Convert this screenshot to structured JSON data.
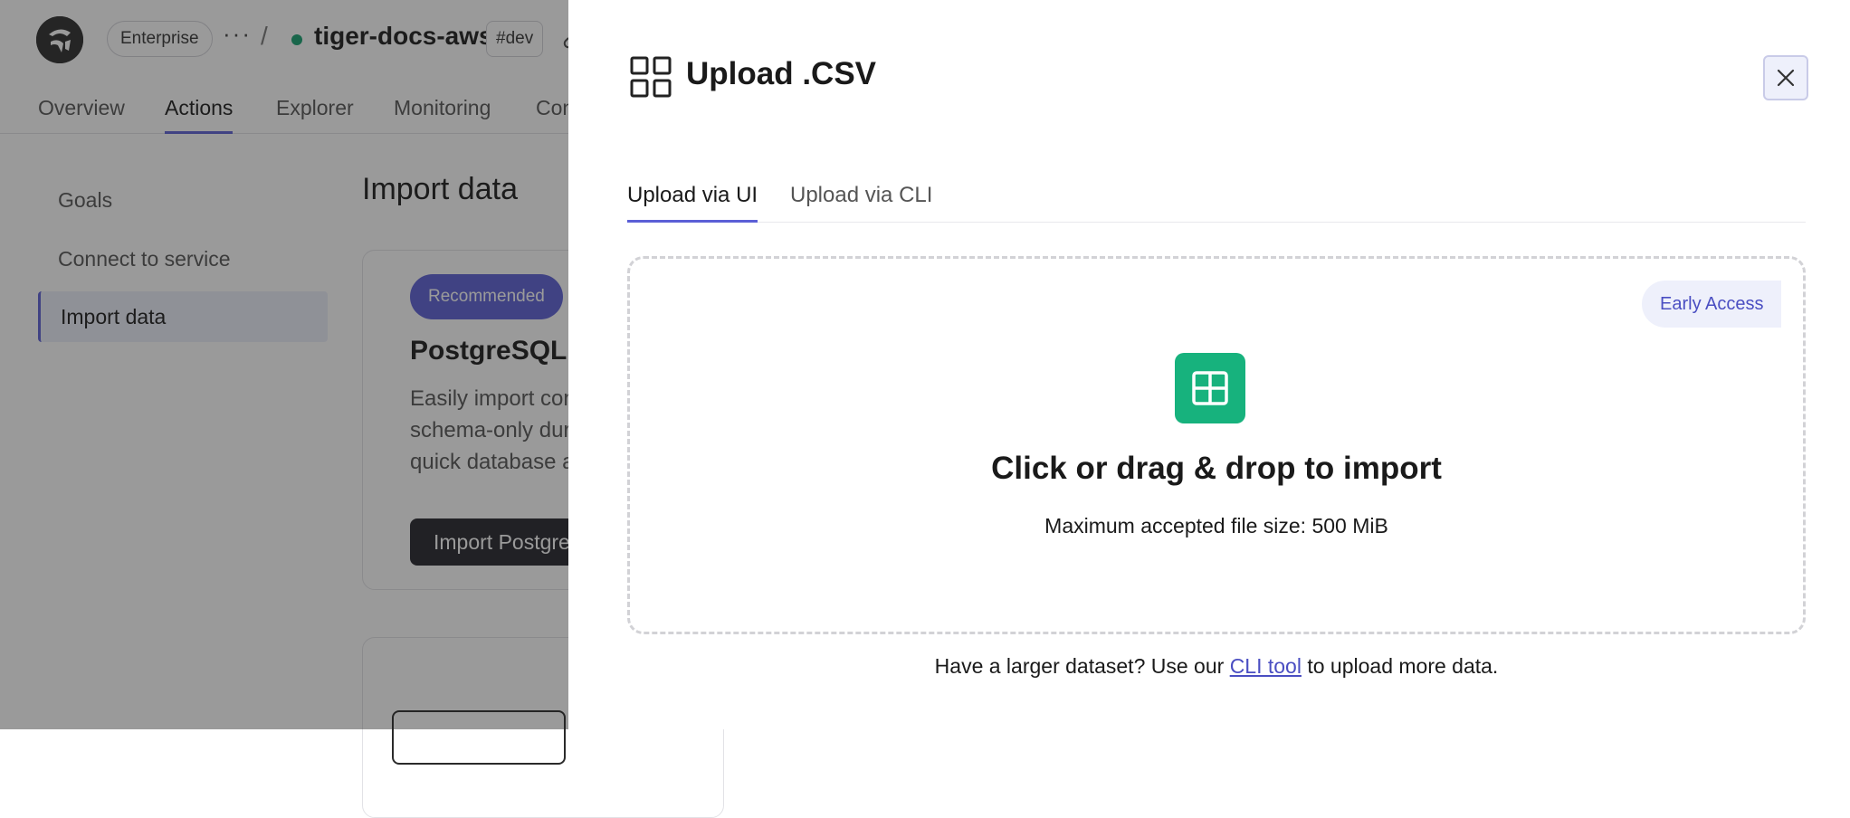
{
  "topbar": {
    "org": "Enterprise",
    "more": "···",
    "separator": "/",
    "service_name": "tiger-docs-aws",
    "env": "#dev"
  },
  "nav": {
    "tabs": [
      {
        "label": "Overview"
      },
      {
        "label": "Actions"
      },
      {
        "label": "Explorer"
      },
      {
        "label": "Monitoring"
      },
      {
        "label": "Conn"
      }
    ]
  },
  "sidebar": {
    "items": [
      {
        "label": "Goals"
      },
      {
        "label": "Connect to service"
      },
      {
        "label": "Import data"
      }
    ]
  },
  "main": {
    "title": "Import data",
    "card": {
      "badge": "Recommended",
      "title": "PostgreSQL I",
      "desc_line1": "Easily import con",
      "desc_line2": "schema-only dur",
      "desc_line3": "quick database a",
      "button": "Import Postgre"
    }
  },
  "modal": {
    "title": "Upload .CSV",
    "tabs": [
      {
        "label": "Upload via UI"
      },
      {
        "label": "Upload via CLI"
      }
    ],
    "badge": "Early Access",
    "drop_title": "Click or drag & drop to import",
    "drop_sub": "Maximum accepted file size: 500 MiB",
    "footer_prefix": "Have a larger dataset? Use our ",
    "footer_link": "CLI tool",
    "footer_suffix": " to upload more data."
  },
  "colors": {
    "accent": "#5b5fd6",
    "sheet_green": "#17b27d",
    "status_green": "#14a070"
  }
}
